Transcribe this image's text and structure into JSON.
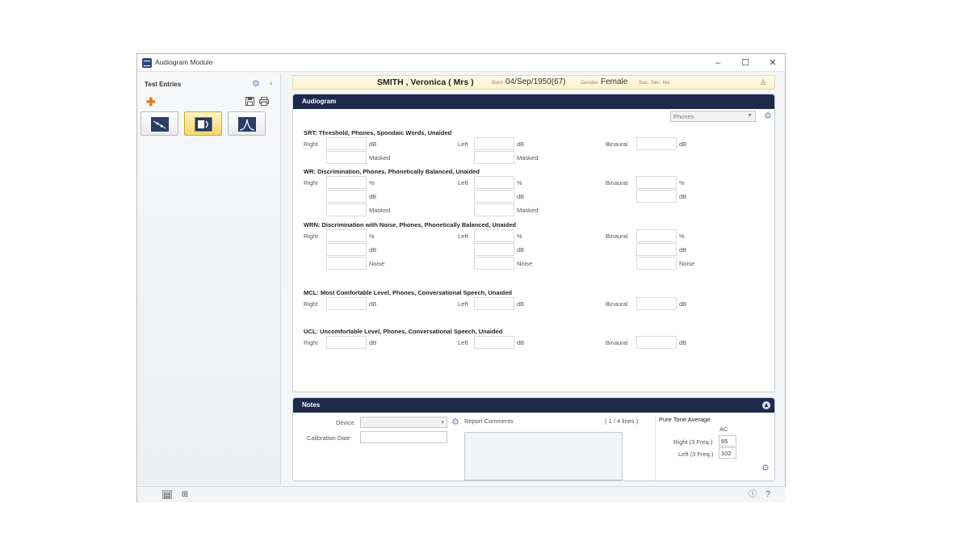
{
  "window": {
    "title": "Audiogram Module",
    "minimize": "–",
    "maximize": "☐",
    "close": "✕"
  },
  "sidebar": {
    "title": "Test Entries",
    "collapse_icon": "‹",
    "buttons": [
      {
        "name": "graph-view",
        "active": false
      },
      {
        "name": "speech-entry",
        "active": true
      },
      {
        "name": "tympanogram",
        "active": false
      }
    ]
  },
  "patient": {
    "name": "SMITH ,  Veronica  ( Mrs )",
    "born_label": "Born",
    "born_value": "04/Sep/1950(67)",
    "gender_label": "Gender",
    "gender_value": "Female",
    "ssn_label": "Soc. Sec. No."
  },
  "audiogram": {
    "title": "Audiogram",
    "transducer": "Phones",
    "sections": {
      "srt": "SRT: Threshold, Phones, Spondaic Words, Unaided",
      "wr": "WR: Discrimination, Phones, Phonetically Balanced, Unaided",
      "wrn": "WRN: Discrimination with Noise, Phones, Phonetically Balanced, Unaided",
      "mcl": "MCL: Most Comfortable Level, Phones, Conversational Speech, Unaided",
      "ucl": "UCL: Uncomfortable Level, Phones, Conversational Speech, Unaided"
    },
    "labels": {
      "right": "Right",
      "left": "Left",
      "binaural": "Binaural",
      "db": "dB",
      "percent": "%",
      "masked": "Masked",
      "noise": "Noise"
    }
  },
  "notes": {
    "title": "Notes",
    "device_label": "Device",
    "calibration_label": "Calibration Date",
    "report_comments_label": "Report Comments",
    "lines_count": "( 1 / 4 lines )",
    "pta": {
      "title": "Pure Tone Average",
      "ac_label": "AC",
      "right_label": "Right (3 Freq.)",
      "right_value": "65",
      "left_label": "Left (3 Freq.)",
      "left_value": "102"
    }
  },
  "icons": {
    "settings": "gear-icon",
    "add": "plus-icon",
    "save": "save-icon",
    "print": "print-icon",
    "person": "person-icon",
    "info": "info-icon",
    "help": "help-icon"
  }
}
